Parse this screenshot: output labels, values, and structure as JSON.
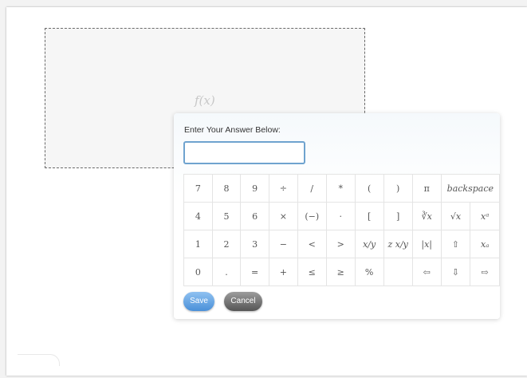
{
  "formula": {
    "placeholder": "f(x)"
  },
  "panel": {
    "label": "Enter Your Answer Below:",
    "answer_value": "",
    "save_label": "Save",
    "cancel_label": "Cancel"
  },
  "keypad": {
    "rows": [
      [
        "7",
        "8",
        "9",
        "÷",
        "/",
        "*",
        "(",
        ")",
        "π",
        "backspace"
      ],
      [
        "4",
        "5",
        "6",
        "×",
        "(−)",
        "·",
        "[",
        "]",
        "∛x",
        "√x",
        "xᵃ"
      ],
      [
        "1",
        "2",
        "3",
        "−",
        "<",
        ">",
        "x/y",
        "z x/y",
        "|x|",
        "⇧",
        "xₐ"
      ],
      [
        "0",
        ".",
        "=",
        "+",
        "≤",
        "≥",
        "%",
        "",
        "⇦",
        "⇩",
        "⇨"
      ]
    ]
  }
}
